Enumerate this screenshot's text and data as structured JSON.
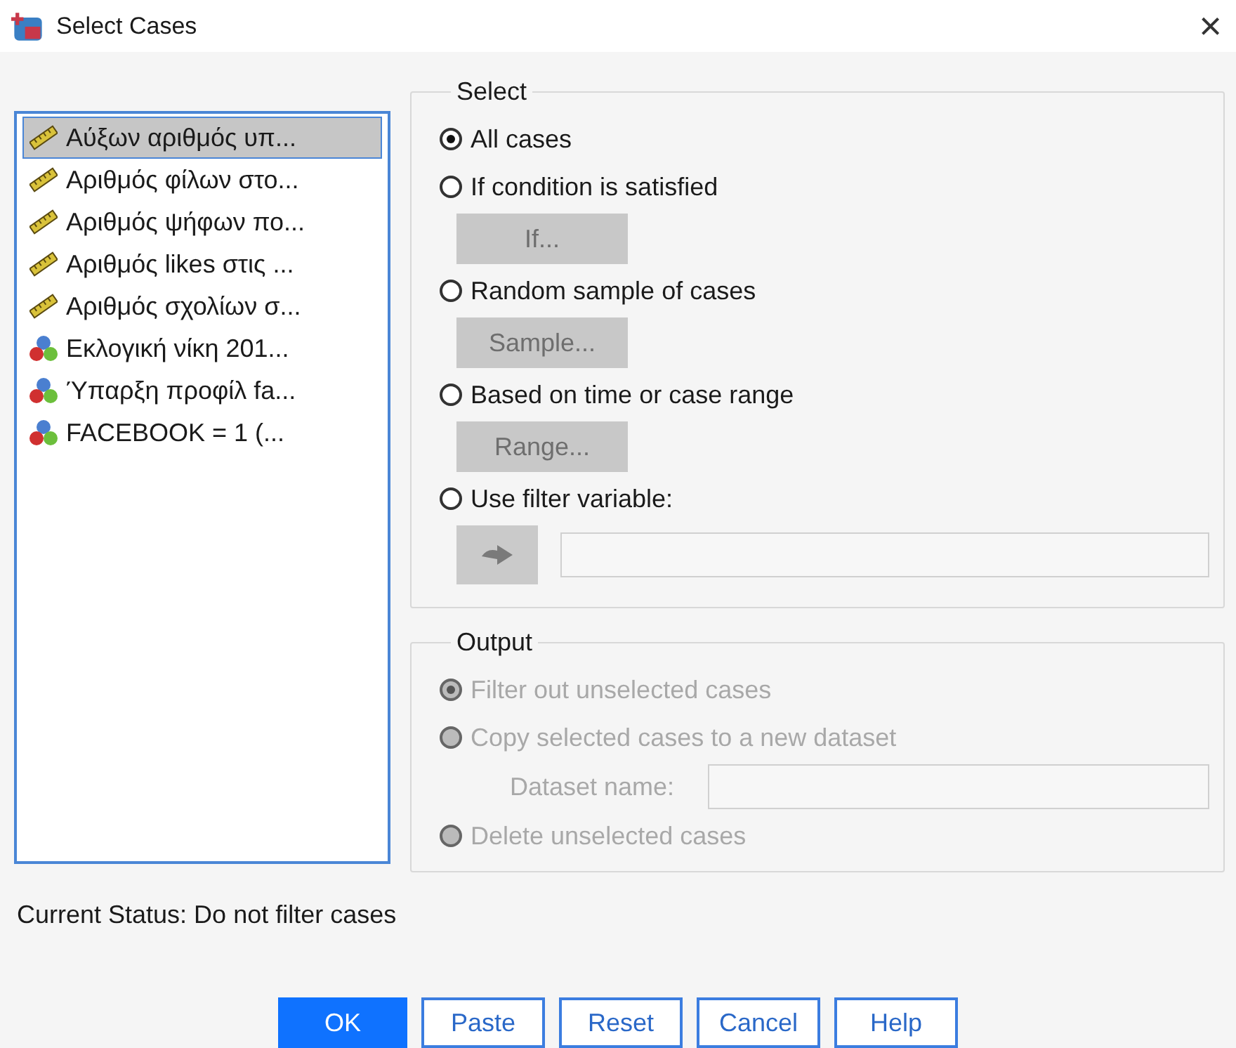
{
  "window": {
    "title": "Select Cases",
    "close": "×"
  },
  "variables": [
    {
      "name": "Αύξων αριθμός υπ...",
      "kind": "scale",
      "selected": true
    },
    {
      "name": "Αριθμός φίλων στο...",
      "kind": "scale",
      "selected": false
    },
    {
      "name": "Αριθμός ψήφων πο...",
      "kind": "scale",
      "selected": false
    },
    {
      "name": "Αριθμός likes στις ...",
      "kind": "scale",
      "selected": false
    },
    {
      "name": "Αριθμός σχολίων σ...",
      "kind": "scale",
      "selected": false
    },
    {
      "name": "Εκλογική νίκη 201...",
      "kind": "nominal",
      "selected": false
    },
    {
      "name": "Ύπαρξη προφίλ fa...",
      "kind": "nominal",
      "selected": false
    },
    {
      "name": "FACEBOOK = 1 (...",
      "kind": "nominal",
      "selected": false
    }
  ],
  "select": {
    "title": "Select",
    "options": [
      {
        "label": "All cases",
        "selected": true
      },
      {
        "label": "If condition is satisfied",
        "selected": false,
        "button": {
          "kind": "text",
          "label": "If...",
          "disabled": true
        }
      },
      {
        "label": "Random sample of cases",
        "selected": false,
        "button": {
          "kind": "text",
          "label": "Sample...",
          "disabled": true
        }
      },
      {
        "label": "Based on time or case range",
        "selected": false,
        "button": {
          "kind": "text",
          "label": "Range...",
          "disabled": true
        }
      },
      {
        "label": "Use filter variable:",
        "selected": false,
        "button": {
          "kind": "arrow",
          "disabled": true
        }
      }
    ]
  },
  "output": {
    "title": "Output",
    "options": [
      {
        "label": "Filter out unselected cases",
        "selected": true,
        "disabled": true
      },
      {
        "label": "Copy selected cases to a new dataset",
        "selected": false,
        "disabled": true,
        "field_label": "Dataset name:"
      },
      {
        "label": "Delete unselected cases",
        "selected": false,
        "disabled": true
      }
    ]
  },
  "status": "Current Status: Do not filter cases",
  "buttons": [
    {
      "label": "OK",
      "default": true
    },
    {
      "label": "Paste",
      "default": false
    },
    {
      "label": "Reset",
      "default": false
    },
    {
      "label": "Cancel",
      "default": false
    },
    {
      "label": "Help",
      "default": false
    }
  ]
}
